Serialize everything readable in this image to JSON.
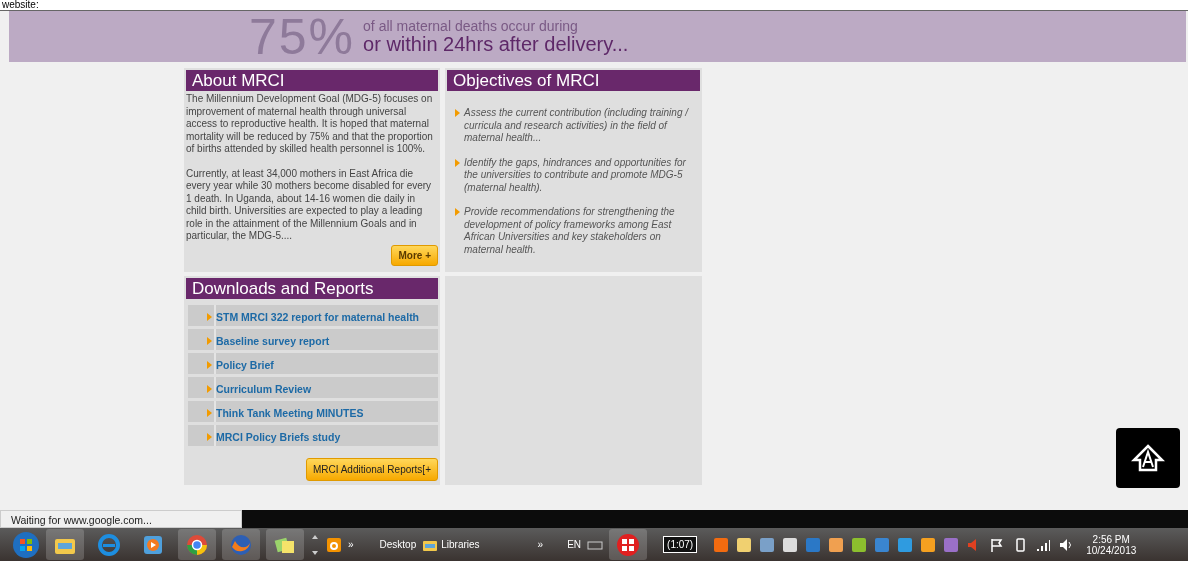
{
  "browser": {
    "top_text": "website:"
  },
  "banner": {
    "percent": "75%",
    "lines": [
      "of all maternal deaths occur during",
      "or within 24hrs after delivery..."
    ]
  },
  "about": {
    "title": "About MRCI",
    "paragraphs": [
      "The Millennium Development Goal (MDG-5) focuses on improvement of maternal health through universal access to reproductive health. It is hoped that maternal mortality will be reduced by 75% and that the proportion of births attended by skilled health personnel is 100%.",
      "Currently, at least 34,000 mothers in East Africa die every year while 30 mothers become disabled for every 1 death. In Uganda, about 14-16 women die daily in child birth. Universities are expected to play a leading role in the attainment of the Millennium Goals and in particular, the MDG-5...."
    ],
    "more_button": "More +"
  },
  "objectives": {
    "title": "Objectives of MRCI",
    "items": [
      "Assess the current contribution (including training / curricula and research activities) in the field of maternal health...",
      "Identify the gaps, hindrances and opportunities for the universities to contribute and promote MDG-5 (maternal health).",
      "Provide recommendations for strengthening the development of policy frameworks among East African Universities and key stakeholders on maternal health."
    ]
  },
  "downloads": {
    "title": "Downloads and Reports",
    "links": [
      "STM MRCI 322 report for maternal health",
      "Baseline survey report",
      "Policy Brief",
      "Curriculum Review",
      "Think Tank Meeting MINUTES",
      "MRCI Policy Briefs study"
    ],
    "button": "MRCI Additional Reports[+"
  },
  "status_bar": {
    "text": "Waiting for www.google.com..."
  },
  "taskbar": {
    "toolbar_chevron": "»",
    "desktop": "Desktop",
    "libraries": "Libraries",
    "chevron": "»",
    "language": "EN",
    "battery": "(1:07)",
    "time": "2:56 PM",
    "date": "10/24/2013"
  }
}
